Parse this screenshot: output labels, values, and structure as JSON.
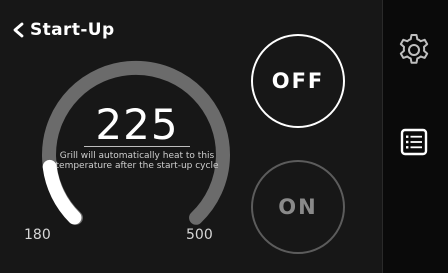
{
  "header": {
    "title": "Start-Up"
  },
  "dial": {
    "value": "225",
    "min": "180",
    "max": "500",
    "hint": "Grill will automatically heat to this temperature after the start-up cycle",
    "level_fraction": 0.14
  },
  "buttons": {
    "off_label": "OFF",
    "on_label": "ON"
  },
  "icons": {
    "back": "chevron-left-icon",
    "settings": "gear-icon",
    "menu": "list-icon"
  },
  "colors": {
    "background": "#171717",
    "sidebar": "#0a0a0a",
    "track": "#6b6b6b",
    "fill": "#ffffff",
    "off_border": "#ffffff",
    "on_border": "#5c5c5c"
  }
}
